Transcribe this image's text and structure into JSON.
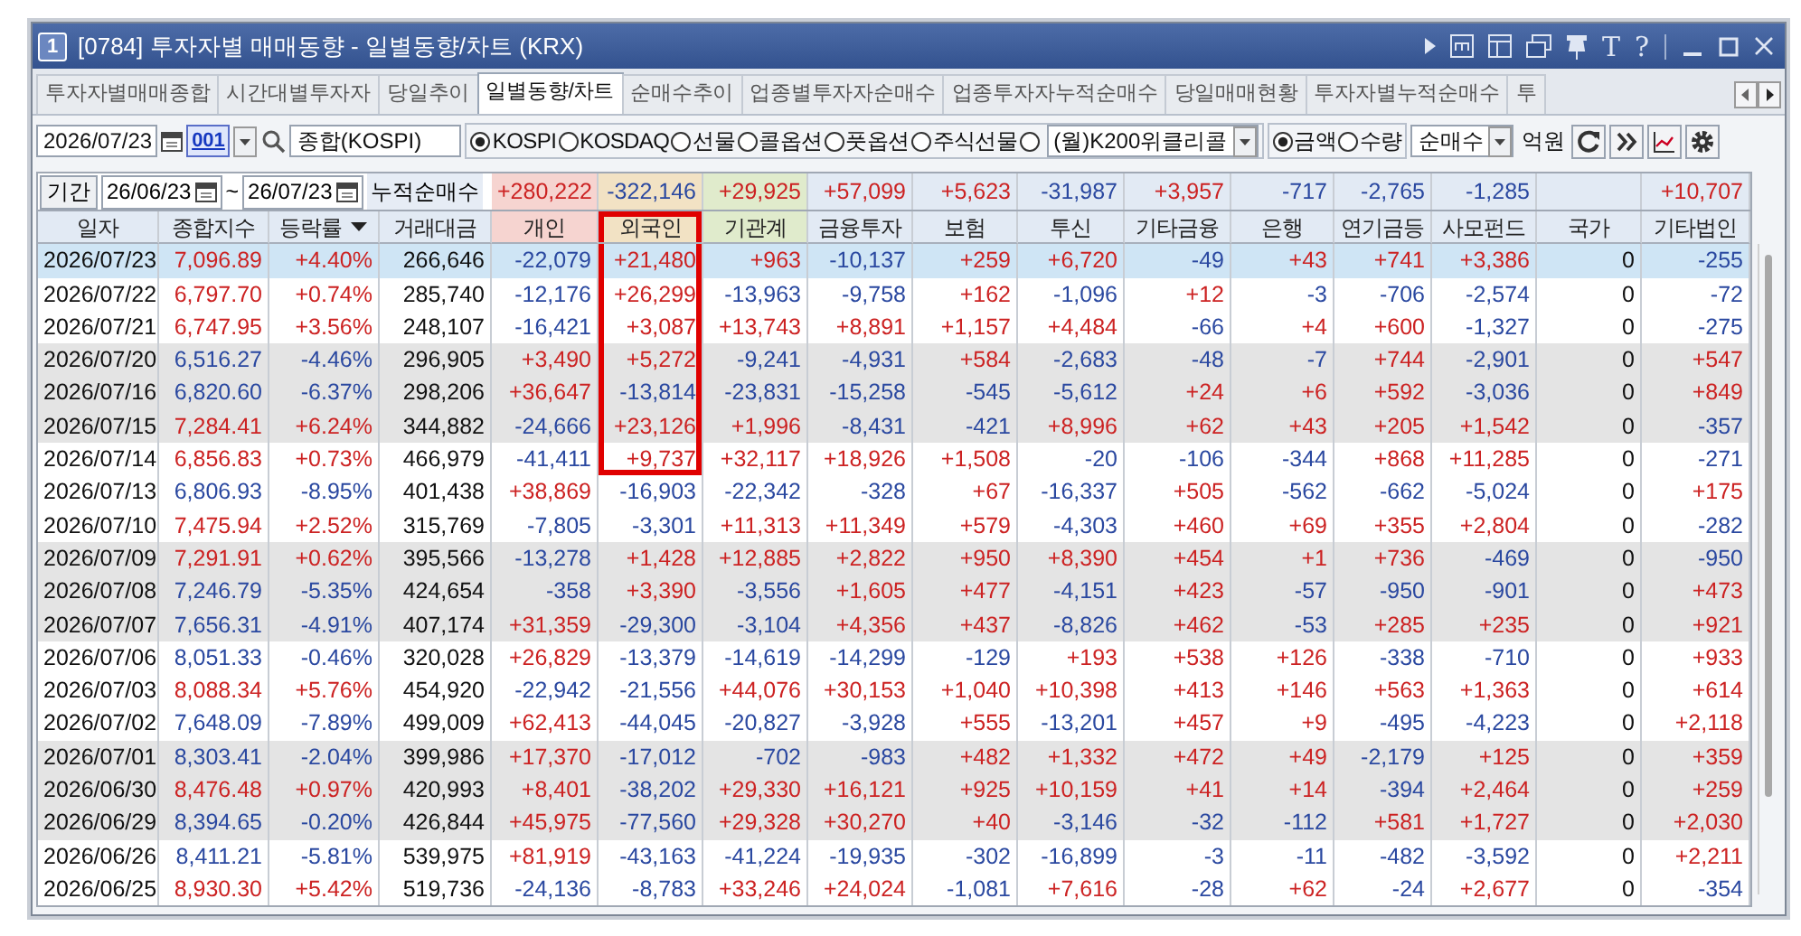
{
  "window": {
    "number": "1",
    "title": "[0784] 투자자별 매매동향 - 일별동향/차트 (KRX)",
    "tool_glyphs": [
      "T",
      "?"
    ]
  },
  "tabs": [
    {
      "label": "투자자별매매종합",
      "selected": false
    },
    {
      "label": "시간대별투자자",
      "selected": false
    },
    {
      "label": "당일추이",
      "selected": false
    },
    {
      "label": "일별동향/차트",
      "selected": true
    },
    {
      "label": "순매수추이",
      "selected": false
    },
    {
      "label": "업종별투자자순매수",
      "selected": false
    },
    {
      "label": "업종투자자누적순매수",
      "selected": false
    },
    {
      "label": "당일매매현황",
      "selected": false
    },
    {
      "label": "투자자별누적순매수",
      "selected": false
    },
    {
      "label": "투",
      "selected": false
    }
  ],
  "toolbar": {
    "date": "2026/07/23",
    "code": "001",
    "market_field": "종합(KOSPI)",
    "markets": [
      {
        "kind": "radio",
        "label": "KOSPI",
        "selected": true
      },
      {
        "kind": "radio",
        "label": "KOSDAQ",
        "selected": false
      },
      {
        "kind": "radio",
        "label": "선물",
        "selected": false
      },
      {
        "kind": "radio",
        "label": "콜옵션",
        "selected": false
      },
      {
        "kind": "radio",
        "label": "풋옵션",
        "selected": false
      },
      {
        "kind": "radio",
        "label": "주식선물",
        "selected": false
      },
      {
        "kind": "dropdown",
        "label": "(월)K200위클리콜",
        "selected": false
      }
    ],
    "units": [
      {
        "label": "금액",
        "selected": true
      },
      {
        "label": "수량",
        "selected": false
      }
    ],
    "mode": "순매수",
    "unit_label": "억원"
  },
  "period": {
    "label": "기간",
    "from": "26/06/23",
    "separator": "~",
    "to": "26/07/23",
    "total_label": "누적순매수"
  },
  "table": {
    "columns": [
      {
        "label": "일자",
        "kind": "date",
        "color": "#e2eaf4",
        "outlined": false
      },
      {
        "label": "종합지수",
        "kind": "index",
        "color": "#e2eaf4",
        "outlined": false
      },
      {
        "label": "등락률",
        "kind": "change",
        "color": "#e2eaf4",
        "outlined": false
      },
      {
        "label": "거래대금",
        "kind": "amount",
        "color": "#e2eaf4",
        "outlined": false
      },
      {
        "label": "개인",
        "kind": "net",
        "color": "#f6d4d0",
        "outlined": false,
        "total": "+280,222"
      },
      {
        "label": "외국인",
        "kind": "net",
        "color": "#f2e2c4",
        "outlined": true,
        "total": "-322,146"
      },
      {
        "label": "기관계",
        "kind": "net",
        "color": "#e0ebcc",
        "outlined": false,
        "total": "+29,925"
      },
      {
        "label": "금융투자",
        "kind": "net",
        "color": "#e2eaf4",
        "outlined": false,
        "total": "+57,099"
      },
      {
        "label": "보험",
        "kind": "net",
        "color": "#e2eaf4",
        "outlined": false,
        "total": "+5,623"
      },
      {
        "label": "투신",
        "kind": "net",
        "color": "#e2eaf4",
        "outlined": false,
        "total": "-31,987"
      },
      {
        "label": "기타금융",
        "kind": "net",
        "color": "#e2eaf4",
        "outlined": false,
        "total": "+3,957"
      },
      {
        "label": "은행",
        "kind": "net",
        "color": "#e2eaf4",
        "outlined": false,
        "total": "-717"
      },
      {
        "label": "연기금등",
        "kind": "net",
        "color": "#e2eaf4",
        "outlined": false,
        "total": "-2,765"
      },
      {
        "label": "사모펀드",
        "kind": "net",
        "color": "#e2eaf4",
        "outlined": false,
        "total": "-1,285"
      },
      {
        "label": "국가",
        "kind": "net",
        "color": "#e2eaf4",
        "outlined": false
      },
      {
        "label": "기타법인",
        "kind": "net",
        "color": "#e2eaf4",
        "outlined": false,
        "total": "+10,707"
      }
    ],
    "rows": [
      {
        "selected": true,
        "outlined": true,
        "cells": [
          "2026/07/23",
          "7,096.89",
          "+4.40%",
          "266,646",
          "-22,079",
          "+21,480",
          "+963",
          "-10,137",
          "+259",
          "+6,720",
          "-49",
          "+43",
          "+741",
          "+3,386",
          "0",
          "-255"
        ]
      },
      {
        "selected": false,
        "outlined": true,
        "cells": [
          "2026/07/22",
          "6,797.70",
          "+0.74%",
          "285,740",
          "-12,176",
          "+26,299",
          "-13,963",
          "-9,758",
          "+162",
          "-1,096",
          "+12",
          "-3",
          "-706",
          "-2,574",
          "0",
          "-72"
        ]
      },
      {
        "selected": false,
        "outlined": true,
        "cells": [
          "2026/07/21",
          "6,747.95",
          "+3.56%",
          "248,107",
          "-16,421",
          "+3,087",
          "+13,743",
          "+8,891",
          "+1,157",
          "+4,484",
          "-66",
          "+4",
          "+600",
          "-1,327",
          "0",
          "-275"
        ]
      },
      {
        "selected": false,
        "outlined": true,
        "cells": [
          "2026/07/20",
          "6,516.27",
          "-4.46%",
          "296,905",
          "+3,490",
          "+5,272",
          "-9,241",
          "-4,931",
          "+584",
          "-2,683",
          "-48",
          "-7",
          "+744",
          "-2,901",
          "0",
          "+547"
        ]
      },
      {
        "selected": false,
        "outlined": true,
        "cells": [
          "2026/07/16",
          "6,820.60",
          "-6.37%",
          "298,206",
          "+36,647",
          "-13,814",
          "-23,831",
          "-15,258",
          "-545",
          "-5,612",
          "+24",
          "+6",
          "+592",
          "-3,036",
          "0",
          "+849"
        ]
      },
      {
        "selected": false,
        "outlined": true,
        "cells": [
          "2026/07/15",
          "7,284.41",
          "+6.24%",
          "344,882",
          "-24,666",
          "+23,126",
          "+1,996",
          "-8,431",
          "-421",
          "+8,996",
          "+62",
          "+43",
          "+205",
          "+1,542",
          "0",
          "-357"
        ]
      },
      {
        "selected": false,
        "outlined": true,
        "cells": [
          "2026/07/14",
          "6,856.83",
          "+0.73%",
          "466,979",
          "-41,411",
          "+9,737",
          "+32,117",
          "+18,926",
          "+1,508",
          "-20",
          "-106",
          "-344",
          "+868",
          "+11,285",
          "0",
          "-271"
        ]
      },
      {
        "selected": false,
        "outlined": false,
        "cells": [
          "2026/07/13",
          "6,806.93",
          "-8.95%",
          "401,438",
          "+38,869",
          "-16,903",
          "-22,342",
          "-328",
          "+67",
          "-16,337",
          "+505",
          "-562",
          "-662",
          "-5,024",
          "0",
          "+175"
        ]
      },
      {
        "selected": false,
        "outlined": false,
        "cells": [
          "2026/07/10",
          "7,475.94",
          "+2.52%",
          "315,769",
          "-7,805",
          "-3,301",
          "+11,313",
          "+11,349",
          "+579",
          "-4,303",
          "+460",
          "+69",
          "+355",
          "+2,804",
          "0",
          "-282"
        ]
      },
      {
        "selected": false,
        "outlined": false,
        "cells": [
          "2026/07/09",
          "7,291.91",
          "+0.62%",
          "395,566",
          "-13,278",
          "+1,428",
          "+12,885",
          "+2,822",
          "+950",
          "+8,390",
          "+454",
          "+1",
          "+736",
          "-469",
          "0",
          "-950"
        ]
      },
      {
        "selected": false,
        "outlined": false,
        "cells": [
          "2026/07/08",
          "7,246.79",
          "-5.35%",
          "424,654",
          "-358",
          "+3,390",
          "-3,556",
          "+1,605",
          "+477",
          "-4,151",
          "+423",
          "-57",
          "-950",
          "-901",
          "0",
          "+473"
        ]
      },
      {
        "selected": false,
        "outlined": false,
        "cells": [
          "2026/07/07",
          "7,656.31",
          "-4.91%",
          "407,174",
          "+31,359",
          "-29,300",
          "-3,104",
          "+4,356",
          "+437",
          "-8,826",
          "+462",
          "-53",
          "+285",
          "+235",
          "0",
          "+921"
        ]
      },
      {
        "selected": false,
        "outlined": false,
        "cells": [
          "2026/07/06",
          "8,051.33",
          "-0.46%",
          "320,028",
          "+26,829",
          "-13,379",
          "-14,619",
          "-14,299",
          "-129",
          "+193",
          "+538",
          "+126",
          "-338",
          "-710",
          "0",
          "+933"
        ]
      },
      {
        "selected": false,
        "outlined": false,
        "cells": [
          "2026/07/03",
          "8,088.34",
          "+5.76%",
          "454,920",
          "-22,942",
          "-21,556",
          "+44,076",
          "+30,153",
          "+1,040",
          "+10,398",
          "+413",
          "+146",
          "+563",
          "+1,363",
          "0",
          "+614"
        ]
      },
      {
        "selected": false,
        "outlined": false,
        "cells": [
          "2026/07/02",
          "7,648.09",
          "-7.89%",
          "499,009",
          "+62,413",
          "-44,045",
          "-20,827",
          "-3,928",
          "+555",
          "-13,201",
          "+457",
          "+9",
          "-495",
          "-4,223",
          "0",
          "+2,118"
        ]
      },
      {
        "selected": false,
        "outlined": false,
        "cells": [
          "2026/07/01",
          "8,303.41",
          "-2.04%",
          "399,986",
          "+17,370",
          "-17,012",
          "-702",
          "-983",
          "+482",
          "+1,332",
          "+472",
          "+49",
          "-2,179",
          "+125",
          "0",
          "+359"
        ]
      },
      {
        "selected": false,
        "outlined": false,
        "cells": [
          "2026/06/30",
          "8,476.48",
          "+0.97%",
          "420,993",
          "+8,401",
          "-38,202",
          "+29,330",
          "+16,121",
          "+925",
          "+10,159",
          "+41",
          "+14",
          "-394",
          "+2,464",
          "0",
          "+259"
        ]
      },
      {
        "selected": false,
        "outlined": false,
        "cells": [
          "2026/06/29",
          "8,394.65",
          "-0.20%",
          "426,844",
          "+45,975",
          "-77,560",
          "+29,328",
          "+30,270",
          "+40",
          "-3,146",
          "-32",
          "-112",
          "+581",
          "+1,727",
          "0",
          "+2,030"
        ]
      },
      {
        "selected": false,
        "outlined": false,
        "cells": [
          "2026/06/26",
          "8,411.21",
          "-5.81%",
          "539,975",
          "+81,919",
          "-43,163",
          "-41,224",
          "-19,935",
          "-302",
          "-16,899",
          "-3",
          "-11",
          "-482",
          "-3,592",
          "0",
          "+2,211"
        ]
      },
      {
        "selected": false,
        "outlined": false,
        "cells": [
          "2026/06/25",
          "8,930.30",
          "+5.42%",
          "519,736",
          "-24,136",
          "-8,783",
          "+33,246",
          "+24,024",
          "-1,081",
          "+7,616",
          "-28",
          "+62",
          "-24",
          "+2,677",
          "0",
          "-354"
        ]
      }
    ]
  }
}
